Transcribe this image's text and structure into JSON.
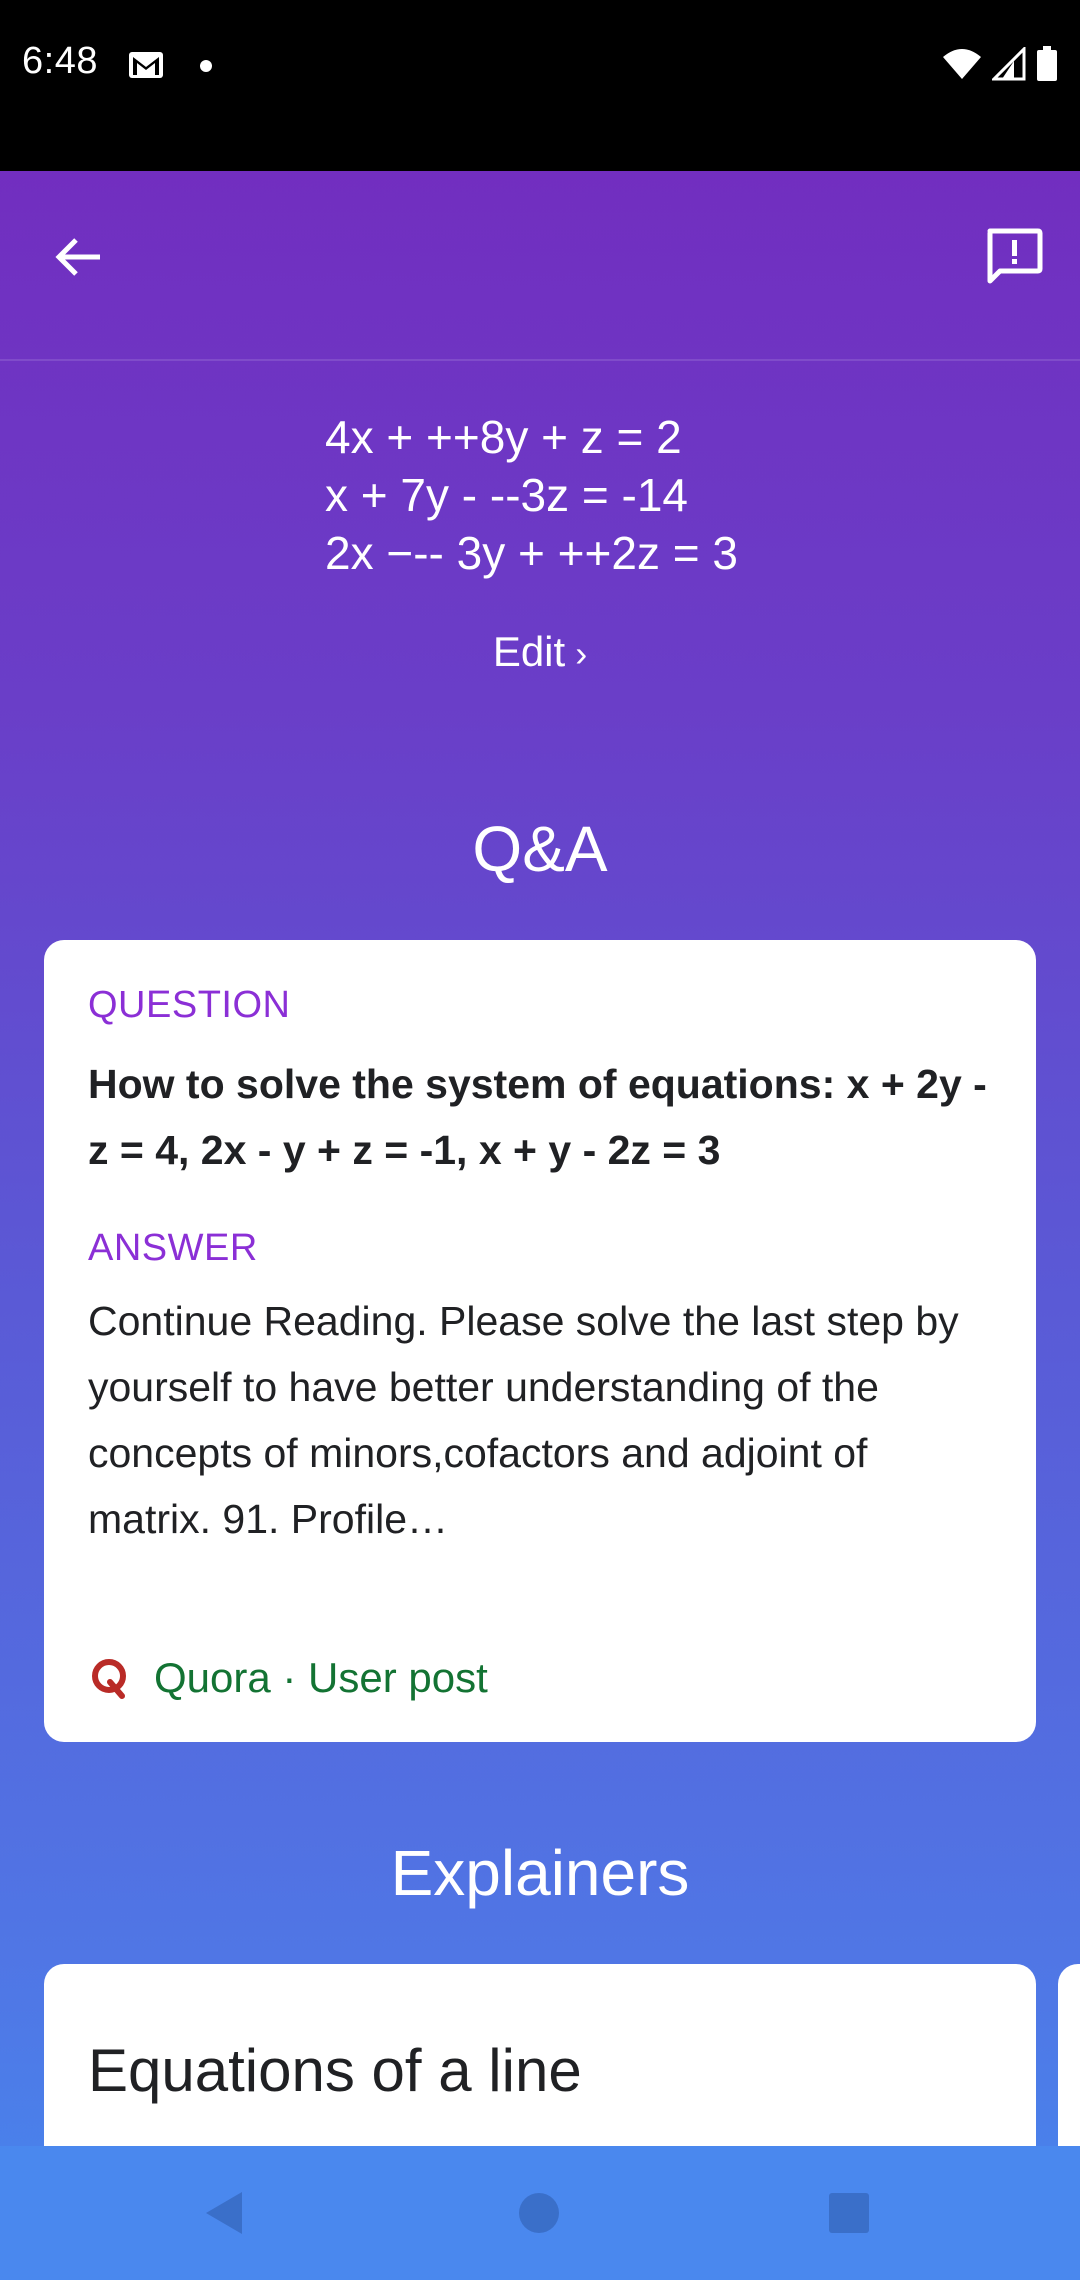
{
  "status_bar": {
    "time": "6:48",
    "icons": [
      "gmail-icon",
      "notification-dot",
      "wifi-icon",
      "cellular-icon",
      "battery-icon"
    ]
  },
  "app_bar": {
    "back_icon": "arrow-back-icon",
    "feedback_icon": "feedback-icon"
  },
  "problem": {
    "equations": [
      "4x + ++8y + z = 2",
      "x + 7y - --3z = -14",
      "2x −-- 3y + ++2z = 3"
    ],
    "edit_label": "Edit",
    "edit_chevron": "›"
  },
  "qa": {
    "section_title": "Q&A",
    "question_label": "QUESTION",
    "question_text": "How to solve the system of equations: x + 2y - z = 4, 2x - y + z = -1, x + y - 2z = 3",
    "answer_label": "ANSWER",
    "answer_text": "Continue Reading. Please solve the last step by yourself to have better understanding of the concepts of minors,cofactors and adjoint of matrix. 91. Profile…",
    "source_text": "Quora · User post",
    "source_icon": "quora-icon"
  },
  "explainers": {
    "section_title": "Explainers",
    "items": [
      {
        "title": "Equations of a line"
      }
    ]
  },
  "nav_bar": {
    "buttons": [
      "back-triangle-icon",
      "home-circle-icon",
      "recents-square-icon"
    ]
  },
  "colors": {
    "accent_purple": "#8b2fd6",
    "source_green": "#137333",
    "quora_red": "#b92b27",
    "gradient_top": "#7429bd",
    "gradient_bottom": "#4a80ea"
  }
}
